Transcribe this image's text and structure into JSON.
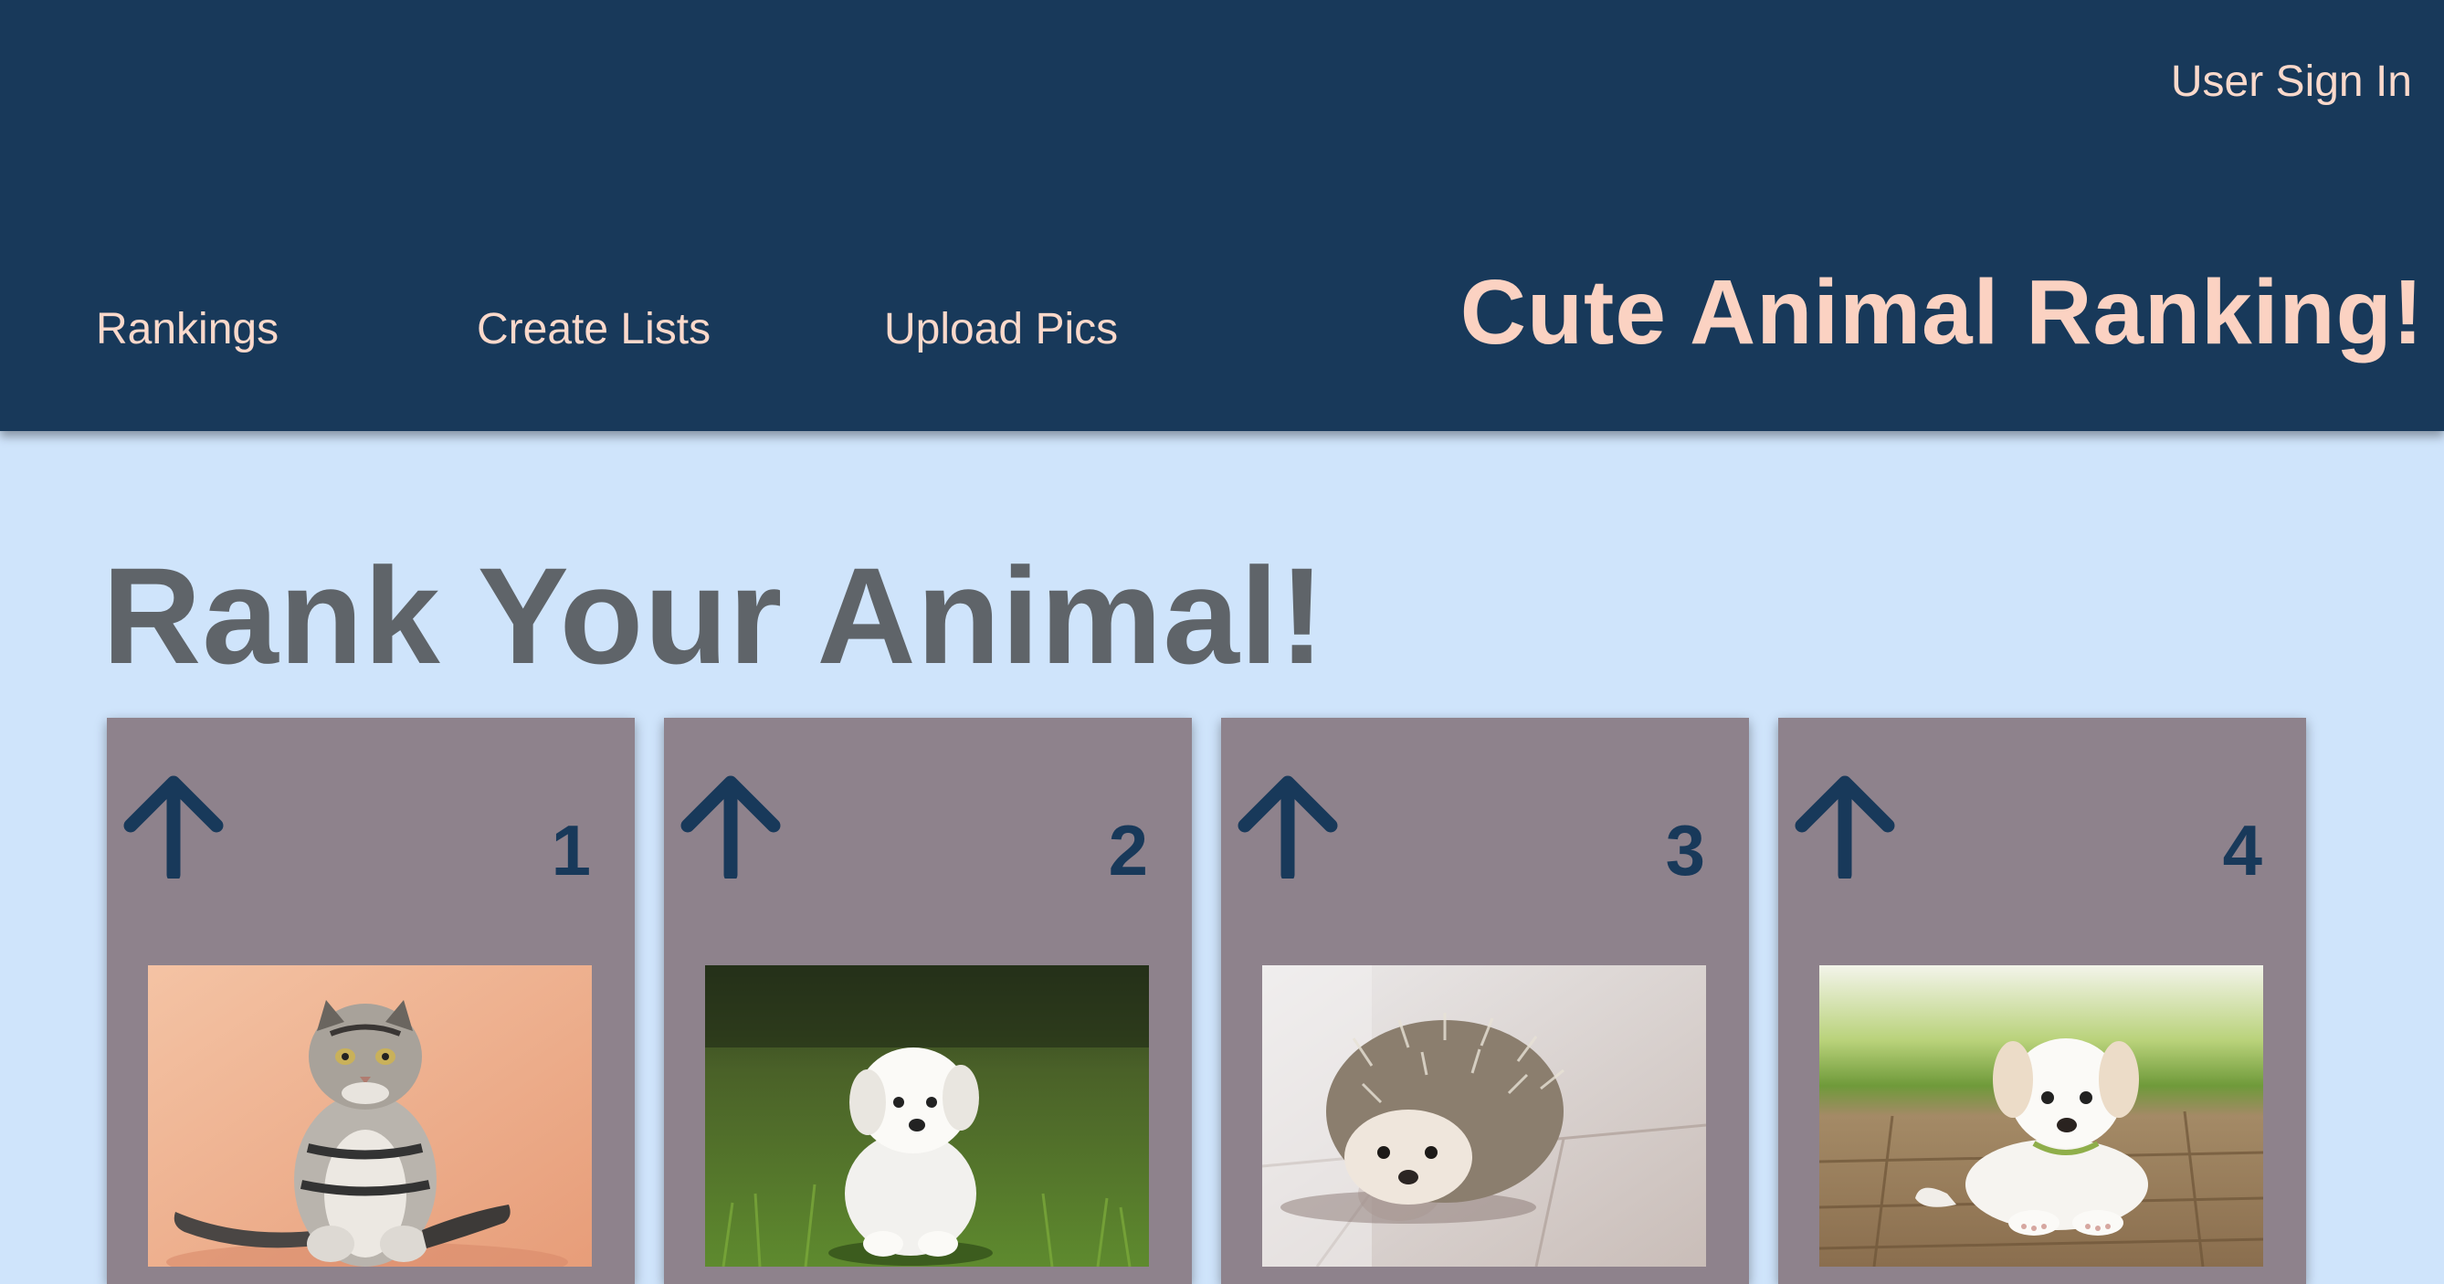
{
  "header": {
    "signin_label": "User Sign In",
    "brand_title": "Cute Animal Ranking!",
    "nav": [
      {
        "label": "Rankings"
      },
      {
        "label": "Create Lists"
      },
      {
        "label": "Upload Pics"
      }
    ]
  },
  "main": {
    "title": "Rank Your Animal!",
    "cards": [
      {
        "rank": "1",
        "animal": "cat",
        "icon": "up-arrow-icon"
      },
      {
        "rank": "2",
        "animal": "white-fluffy-dog",
        "icon": "up-arrow-icon"
      },
      {
        "rank": "3",
        "animal": "hedgehog",
        "icon": "up-arrow-icon"
      },
      {
        "rank": "4",
        "animal": "white-puppy",
        "icon": "up-arrow-icon"
      }
    ]
  },
  "colors": {
    "header_bg": "#18395a",
    "page_bg": "#cfe4fb",
    "card_bg": "#8e828c",
    "accent_text": "#fbd9cb",
    "title_text": "#5f6469"
  }
}
